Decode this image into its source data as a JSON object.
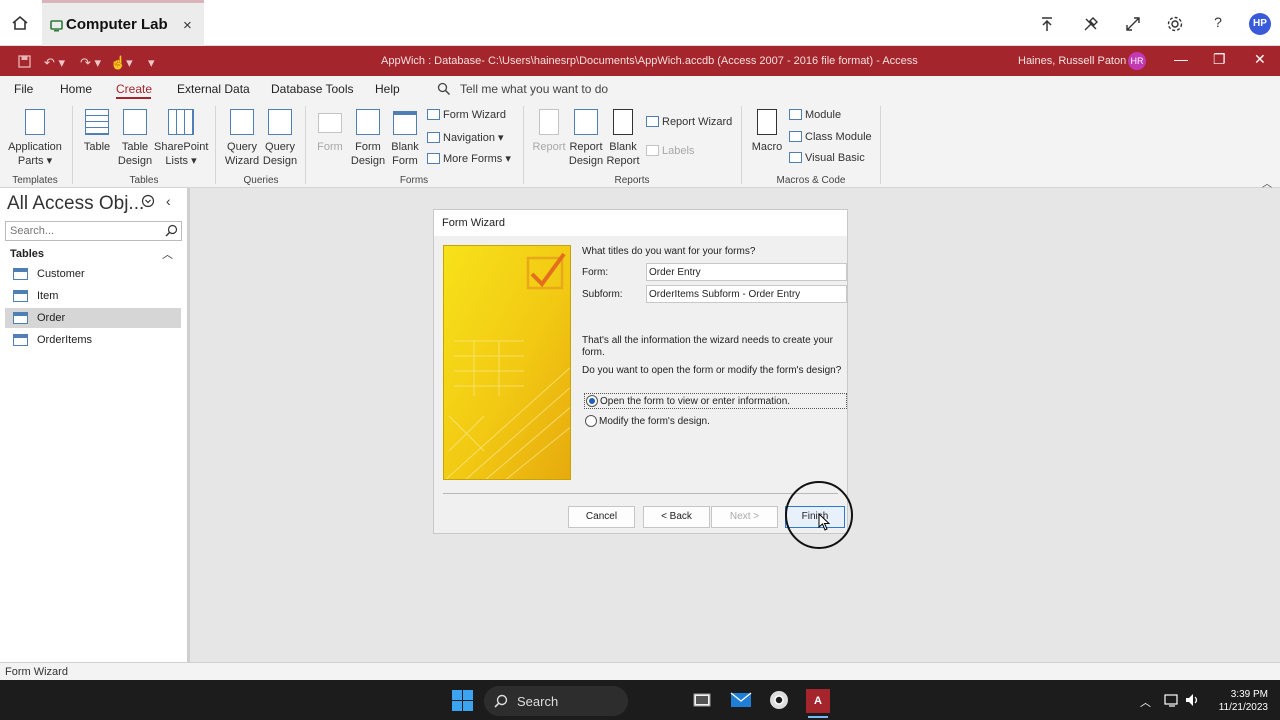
{
  "remote_bar": {
    "tab_title": "Computer Lab",
    "tab_close": "×",
    "avatar": "HP"
  },
  "titlebar": {
    "text": "AppWich : Database- C:\\Users\\hainesrp\\Documents\\AppWich.accdb (Access 2007 - 2016 file format)  -  Access",
    "user": "Haines, Russell Paton",
    "user_initials": "HR",
    "accent": "#a4262c"
  },
  "menu": {
    "file": "File",
    "home": "Home",
    "create": "Create",
    "external": "External Data",
    "dbtools": "Database Tools",
    "help": "Help",
    "tell_me": "Tell me what you want to do"
  },
  "ribbon": {
    "app_parts": [
      "Application",
      "Parts ▾"
    ],
    "table": "Table",
    "table_design": [
      "Table",
      "Design"
    ],
    "sharepoint": [
      "SharePoint",
      "Lists ▾"
    ],
    "query_wizard": [
      "Query",
      "Wizard"
    ],
    "query_design": [
      "Query",
      "Design"
    ],
    "form": "Form",
    "form_design": [
      "Form",
      "Design"
    ],
    "blank_form": [
      "Blank",
      "Form"
    ],
    "form_wizard": "Form Wizard",
    "navigation": "Navigation ▾",
    "more_forms": "More Forms ▾",
    "report": "Report",
    "report_design": [
      "Report",
      "Design"
    ],
    "blank_report": [
      "Blank",
      "Report"
    ],
    "report_wizard": "Report Wizard",
    "labels": "Labels",
    "macro": "Macro",
    "module": "Module",
    "class_module": "Class Module",
    "visual_basic": "Visual Basic",
    "groups": {
      "templates": "Templates",
      "tables": "Tables",
      "queries": "Queries",
      "forms": "Forms",
      "reports": "Reports",
      "macros": "Macros & Code"
    }
  },
  "navpane": {
    "title": "All Access Obj...",
    "search_placeholder": "Search...",
    "section": "Tables",
    "items": [
      "Customer",
      "Item",
      "Order",
      "OrderItems"
    ]
  },
  "status": {
    "text": "Form Wizard"
  },
  "taskbar": {
    "search": "Search",
    "time": "3:39 PM",
    "date": "11/21/2023"
  },
  "dialog": {
    "title": "Form Wizard",
    "question": "What titles do you want for your forms?",
    "form_label": "Form:",
    "form_value": "Order Entry",
    "subform_label": "Subform:",
    "subform_value": "OrderItems Subform - Order Entry",
    "info": "That's all the information the wizard needs to create your form.",
    "question2": "Do you want to open the form or modify the form's design?",
    "option_open": "Open the form to view or enter information.",
    "option_modify": "Modify the form's design.",
    "cancel": "Cancel",
    "back": "< Back",
    "next": "Next >",
    "finish": "Finish"
  }
}
